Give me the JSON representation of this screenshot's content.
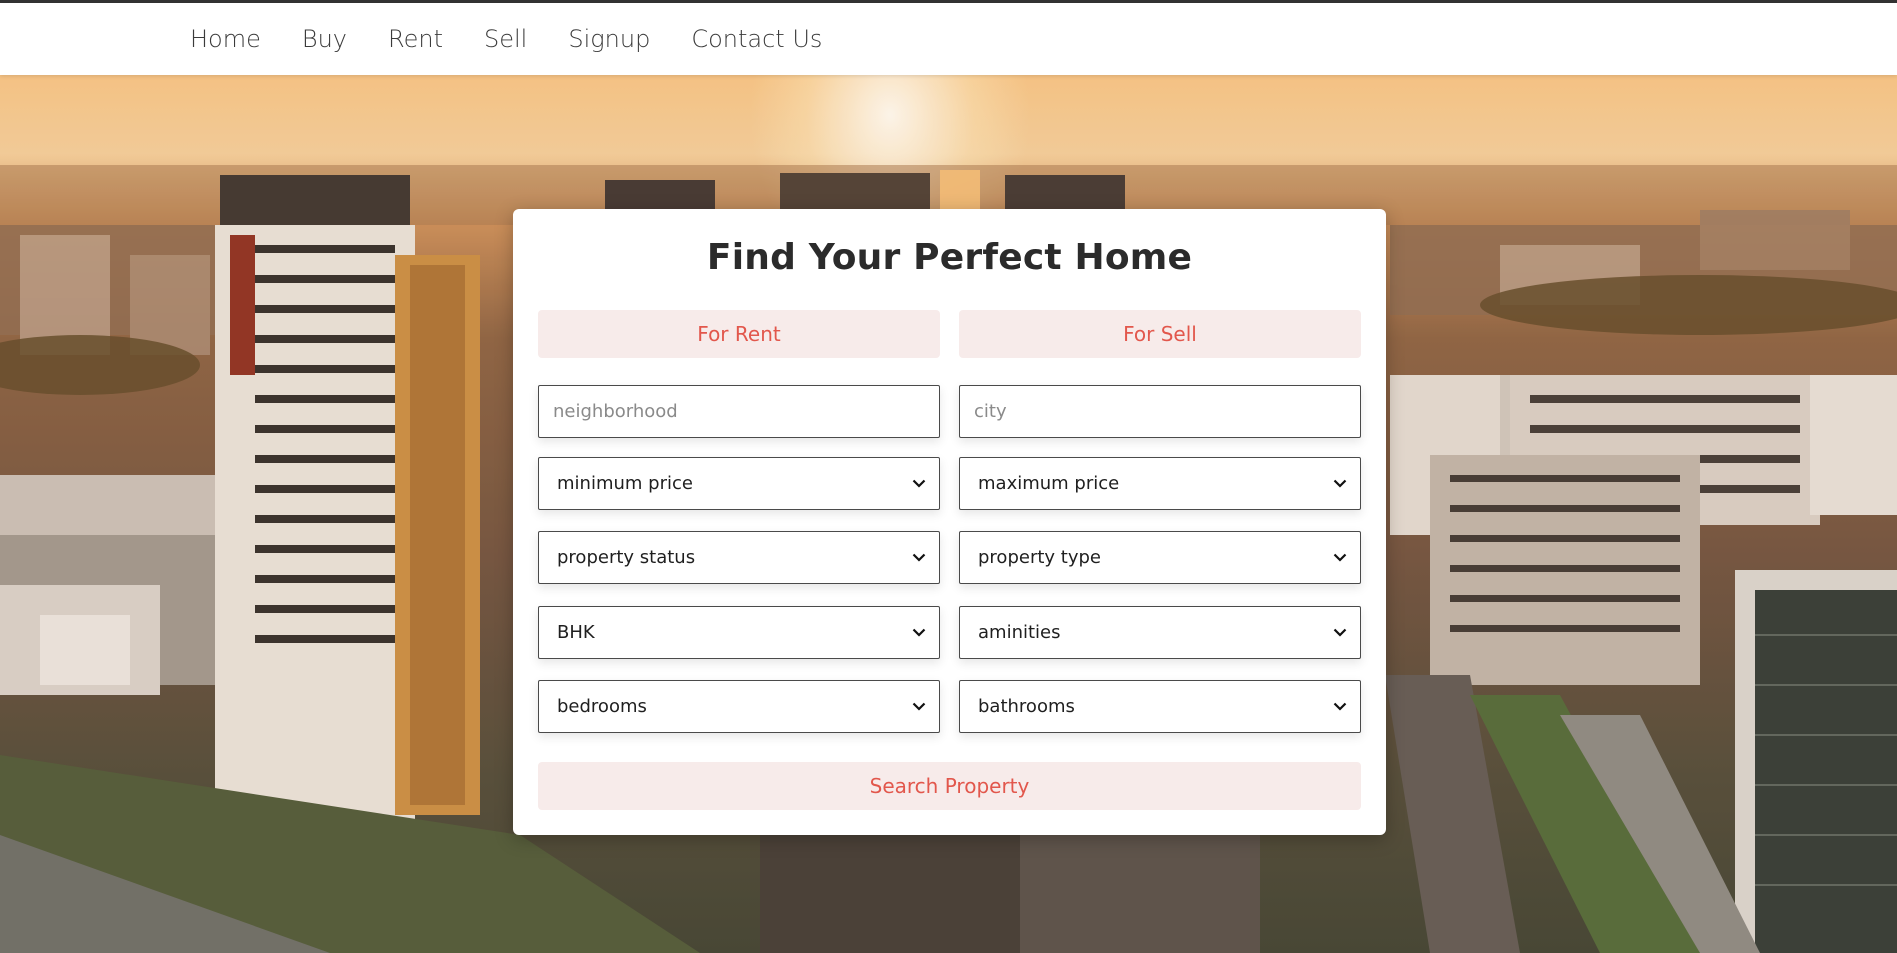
{
  "nav": {
    "items": [
      {
        "label": "Home"
      },
      {
        "label": "Buy"
      },
      {
        "label": "Rent"
      },
      {
        "label": "Sell"
      },
      {
        "label": "Signup"
      },
      {
        "label": "Contact Us"
      }
    ]
  },
  "search_card": {
    "title": "Find Your Perfect Home",
    "tabs": {
      "rent": "For Rent",
      "sell": "For Sell"
    },
    "inputs": {
      "neighborhood_placeholder": "neighborhood",
      "city_placeholder": "city"
    },
    "selects": {
      "min_price": "minimum price",
      "max_price": "maximum price",
      "property_status": "property status",
      "property_type": "property type",
      "bhk": "BHK",
      "amenities": "aminities",
      "bedrooms": "bedrooms",
      "bathrooms": "bathrooms"
    },
    "search_button": "Search Property"
  },
  "colors": {
    "accent": "#e2574c",
    "pill_background": "#f7ebea",
    "nav_text": "#3b3b3b"
  },
  "icons": {
    "select_arrow": "chevron-down-icon"
  }
}
